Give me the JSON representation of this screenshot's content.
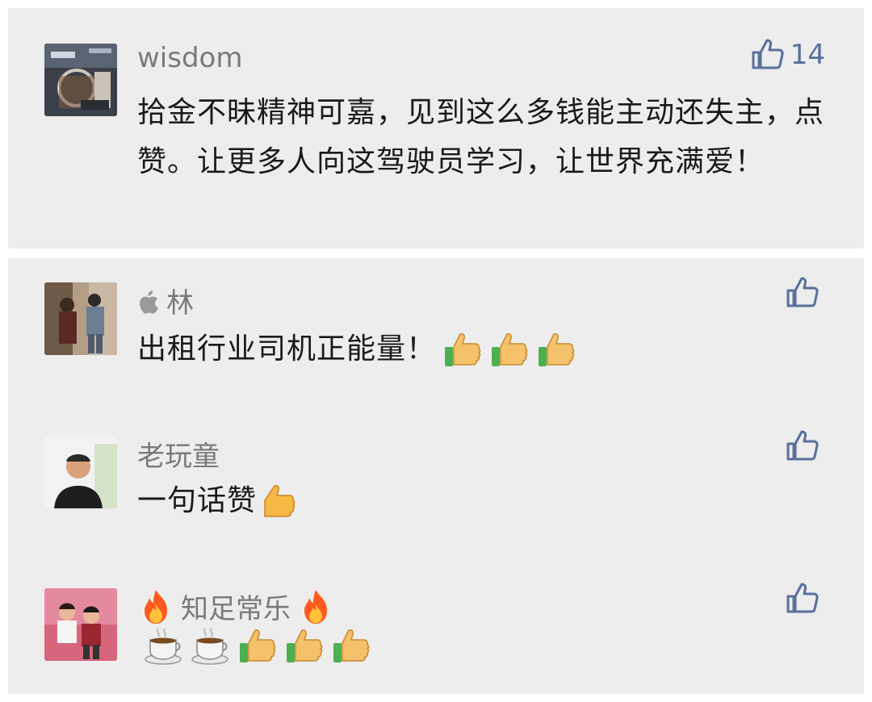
{
  "comments": [
    {
      "name": "wisdom",
      "text": "拾金不昧精神可嘉，见到这么多钱能主动还失主，点赞。让更多人向这驾驶员学习，让世界充满爱！",
      "like_count": "14",
      "avatar_icon": "avatar-photo"
    },
    {
      "name": "林",
      "name_prefix_icon": "apple-icon",
      "text": "出租行业司机正能量！",
      "trailing_emojis": [
        "thumbs-up-emoji",
        "thumbs-up-emoji",
        "thumbs-up-emoji"
      ],
      "like_count": ""
    },
    {
      "name": "老玩童",
      "text": "一句话赞",
      "trailing_emojis": [
        "thumbs-up-emoji"
      ],
      "like_count": ""
    },
    {
      "name": "知足常乐",
      "name_decorations": [
        "fire-emoji",
        "fire-emoji"
      ],
      "text": "",
      "trailing_emojis": [
        "coffee-emoji",
        "coffee-emoji",
        "thumbs-up-emoji",
        "thumbs-up-emoji",
        "thumbs-up-emoji"
      ],
      "like_count": ""
    }
  ],
  "colors": {
    "card_background": "#ededed",
    "name_text": "#7a7a7a",
    "body_text": "#1a1a1a",
    "like_accent": "#59709b"
  }
}
